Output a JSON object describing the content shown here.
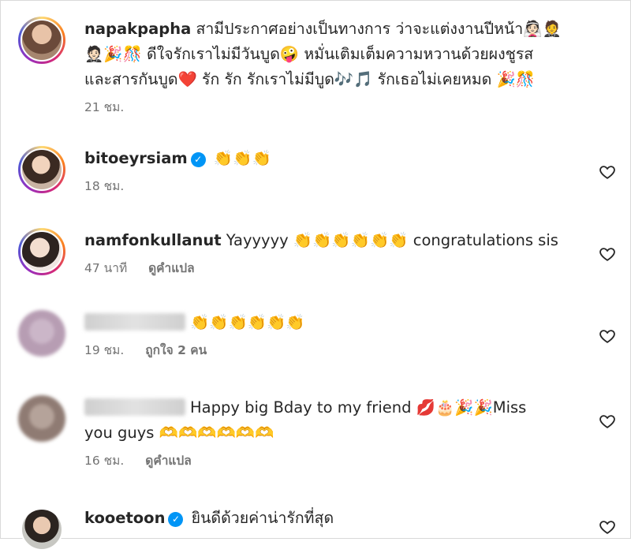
{
  "comments": [
    {
      "username": "napakpapha",
      "verified": false,
      "lines": [
        "สามีประกาศอย่างเป็นทางการ ว่าจะแต่งงานปีหน้า👰🏻🤵",
        "🤵🏻🎉🎊 ดีใจรักเราไม่มีวันบูด🤪 หมั่นเติมเต็มความหวานด้วยผงชูรส",
        "และสารกันบูด❤️ รัก รัก รักเราไม่มีบูด🎶🎵 รักเธอไม่เคยหมด 🎉🎊"
      ],
      "time": "21 ชม.",
      "likes": "",
      "translate": ""
    },
    {
      "username": "bitoeyrsiam",
      "verified": true,
      "lines": [
        "👏👏👏"
      ],
      "time": "18 ชม.",
      "likes": "",
      "translate": ""
    },
    {
      "username": "namfonkullanut",
      "verified": false,
      "lines": [
        "Yayyyyy 👏👏👏👏👏👏 congratulations sis"
      ],
      "time": "47 นาที",
      "likes": "",
      "translate": "ดูคำแปล"
    },
    {
      "username": "",
      "verified": false,
      "lines": [
        "👏👏👏👏👏👏"
      ],
      "time": "19 ชม.",
      "likes": "ถูกใจ 2 คน",
      "translate": ""
    },
    {
      "username": "",
      "verified": false,
      "lines": [
        "Happy big Bday to my friend 💋🎂🎉🎉Miss",
        "you guys 🫶🫶🫶🫶🫶🫶"
      ],
      "time": "16 ชม.",
      "likes": "",
      "translate": "ดูคำแปล"
    },
    {
      "username": "kooetoon",
      "verified": true,
      "lines": [
        "ยินดีด้วยค่าน่ารักที่สุด"
      ],
      "time": "",
      "likes": "",
      "translate": ""
    }
  ],
  "icons": {
    "like": "heart-outline-icon",
    "verified": "verified-badge-icon"
  },
  "colors": {
    "text": "#262626",
    "meta": "#737373",
    "verified": "#0095f6"
  }
}
